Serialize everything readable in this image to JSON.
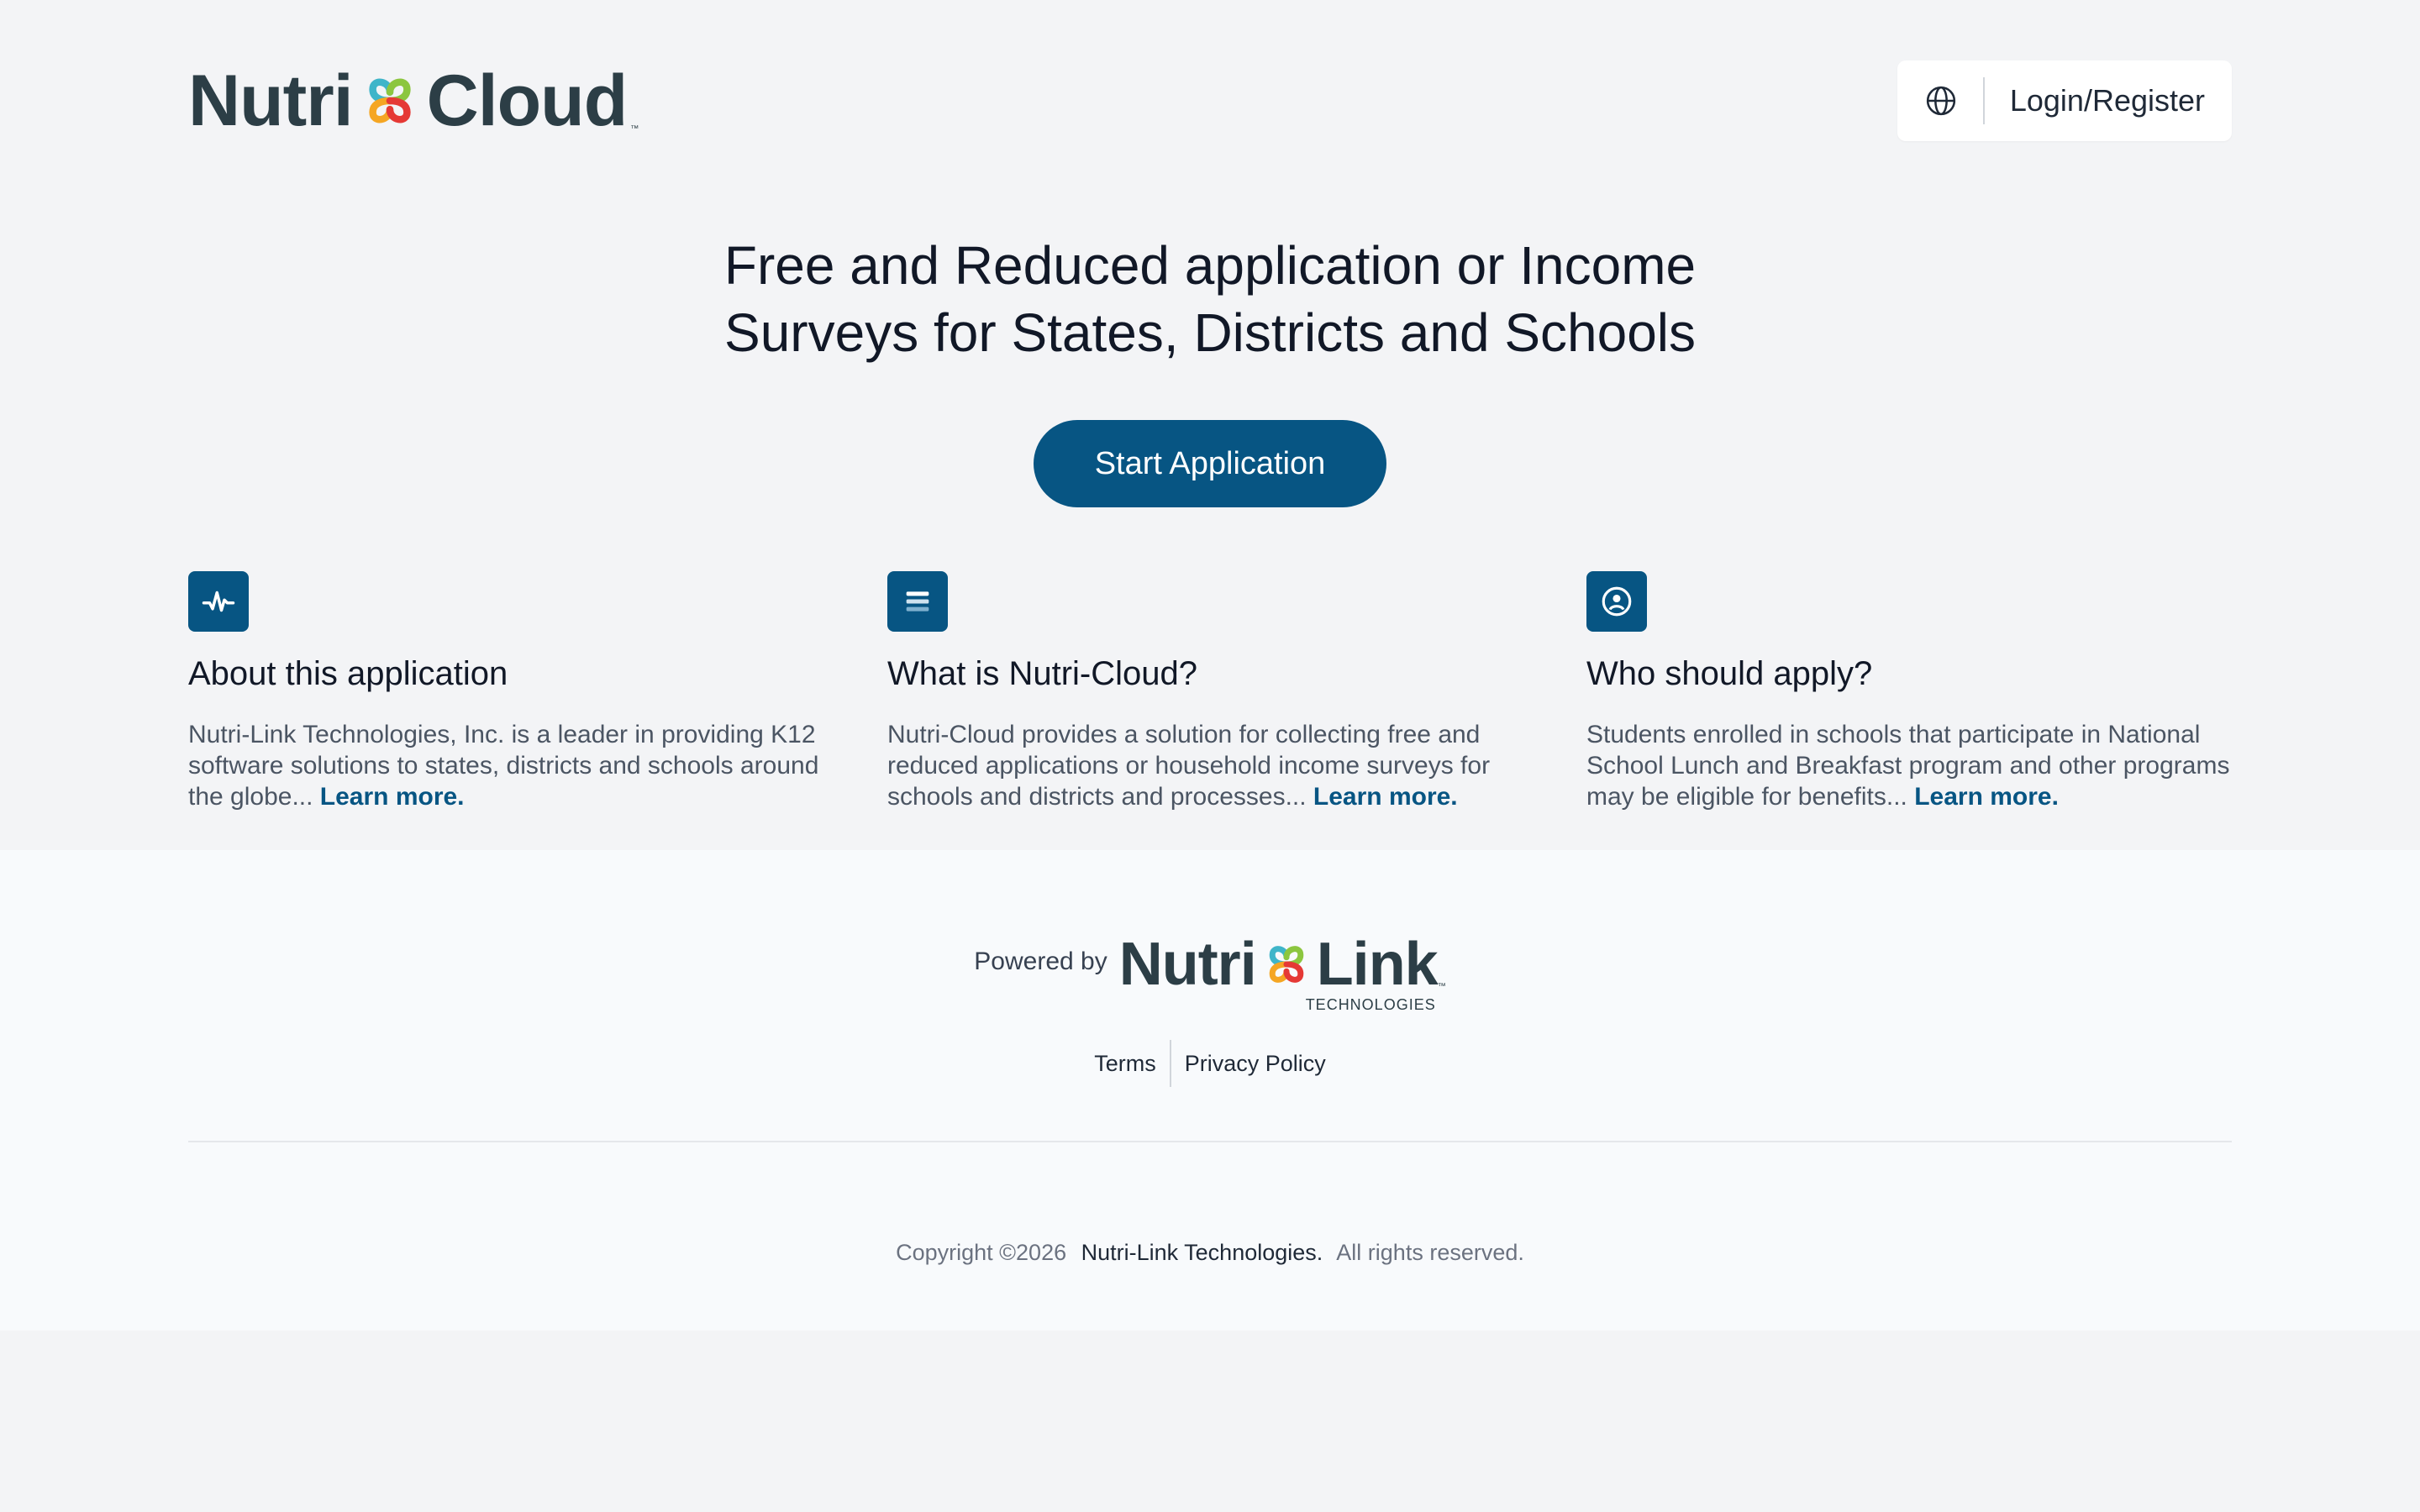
{
  "header": {
    "brand": {
      "left": "Nutri",
      "right": "Cloud",
      "tm": "™"
    },
    "language_icon": "globe-icon",
    "login_label": "Login/Register"
  },
  "hero": {
    "title_line1": "Free and Reduced application or Income",
    "title_line2": "Surveys for States, Districts and Schools",
    "start_label": "Start Application"
  },
  "features": [
    {
      "icon": "activity-icon",
      "title": "About this application",
      "body": "Nutri-Link Technologies, Inc. is a leader in providing K12 software solutions to states, districts and schools around the globe... ",
      "link": "Learn more."
    },
    {
      "icon": "list-icon",
      "title": "What is Nutri-Cloud?",
      "body": "Nutri-Cloud provides a solution for collecting free and reduced applications or household income surveys for schools and districts and processes... ",
      "link": "Learn more."
    },
    {
      "icon": "user-circle-icon",
      "title": "Who should apply?",
      "body": "Students enrolled in schools that participate in National School Lunch and Breakfast program and other programs may be eligible for benefits... ",
      "link": "Learn more."
    }
  ],
  "footer": {
    "powered_by": "Powered by",
    "logo": {
      "left": "Nutri",
      "right": "Link",
      "sub": "TECHNOLOGIES",
      "tm": "™"
    },
    "links": [
      "Terms",
      "Privacy Policy"
    ],
    "copyright_prefix": "Copyright ©2026",
    "company": "Nutri-Link Technologies.",
    "rights": "All rights reserved."
  },
  "colors": {
    "primary": "#075583",
    "background": "#f3f4f6",
    "footer_background": "#f8fafc",
    "brand_text": "#2c3e46"
  }
}
